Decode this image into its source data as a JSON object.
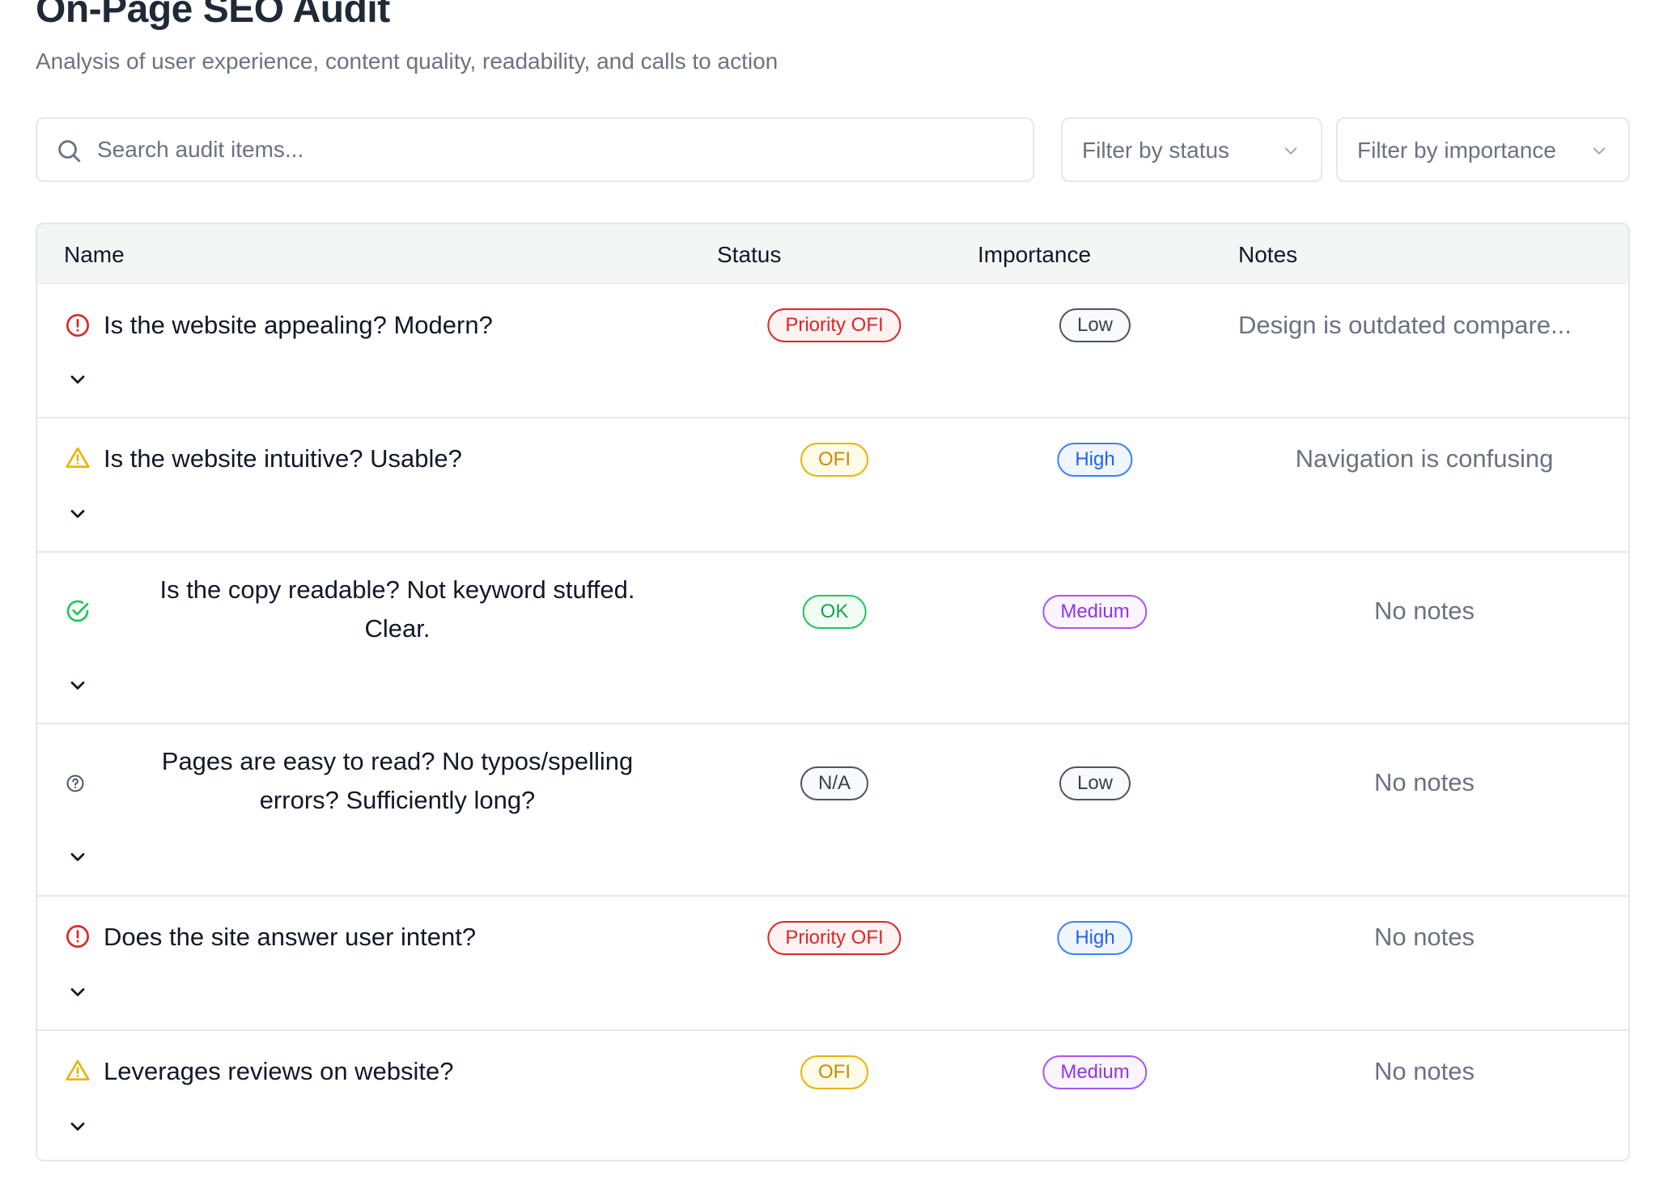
{
  "header": {
    "title": "On-Page SEO Audit",
    "subtitle": "Analysis of user experience, content quality, readability, and calls to action"
  },
  "toolbar": {
    "search_placeholder": "Search audit items...",
    "search_value": "",
    "filter_status_label": "Filter by status",
    "filter_importance_label": "Filter by importance"
  },
  "table": {
    "columns": {
      "name": "Name",
      "status": "Status",
      "importance": "Importance",
      "notes": "Notes"
    },
    "rows": [
      {
        "status_icon": "alert-circle-icon",
        "name": "Is the website appealing? Modern?",
        "status": "Priority OFI",
        "importance": "Low",
        "notes": "Design is outdated compare..."
      },
      {
        "status_icon": "warning-triangle-icon",
        "name": "Is the website intuitive? Usable?",
        "status": "OFI",
        "importance": "High",
        "notes": "Navigation is confusing"
      },
      {
        "status_icon": "check-circle-icon",
        "name": "Is the copy readable? Not keyword stuffed. Clear.",
        "status": "OK",
        "importance": "Medium",
        "notes": "No notes"
      },
      {
        "status_icon": "help-circle-icon",
        "name": "Pages are easy to read? No typos/spelling errors? Sufficiently long?",
        "status": "N/A",
        "importance": "Low",
        "notes": "No notes"
      },
      {
        "status_icon": "alert-circle-icon",
        "name": "Does the site answer user intent?",
        "status": "Priority OFI",
        "importance": "High",
        "notes": "No notes"
      },
      {
        "status_icon": "warning-triangle-icon",
        "name": "Leverages reviews on website?",
        "status": "OFI",
        "importance": "Medium",
        "notes": "No notes"
      }
    ]
  },
  "colors": {
    "priority_ofi": "#dc2626",
    "ofi": "#ca8a04",
    "ok": "#16a34a",
    "na": "#4b5563",
    "high": "#2563eb",
    "medium": "#9333ea",
    "low": "#4b5563"
  }
}
